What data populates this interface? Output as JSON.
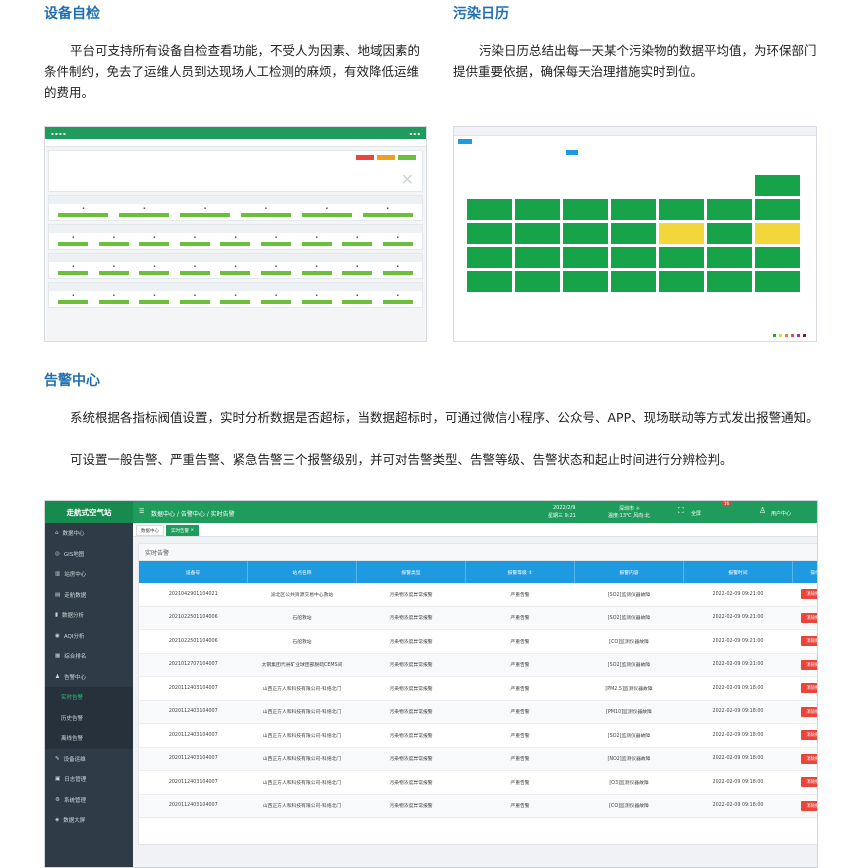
{
  "sections": {
    "self_check": {
      "title": "设备自检",
      "para": "平台可支持所有设备自检查看功能，不受人为因素、地域因素的条件制约，免去了运维人员到达现场人工检测的麻烦，有效降低运维的费用。"
    },
    "calendar": {
      "title": "污染日历",
      "para": "污染日历总结出每一天某个污染物的数据平均值，为环保部门提供重要依据，确保每天治理措施实时到位。"
    },
    "alarm": {
      "title": "告警中心",
      "para1": "系统根据各指标阀值设置，实时分析数据是否超标，当数据超标时，可通过微信小程序、公众号、APP、现场联动等方式发出报警通知。",
      "para2": "可设置一般告警、严重告警、紧急告警三个报警级别，并可对告警类型、告警等级、告警状态和起止时间进行分辨检判。"
    }
  },
  "app": {
    "logo": "走航式空气站",
    "breadcrumb": "数据中心 / 告警中心 / 实时告警",
    "date": "2022/2/9",
    "weekday_time": "星期三 9:21",
    "location": "深圳市 ☼",
    "weather": "温度:13℃ 风向:北",
    "fullscreen": "全屏",
    "badge": "16",
    "user": "用户中心",
    "tabs": [
      "数据中心",
      "实时告警"
    ],
    "panel_title": "实时告警",
    "sidebar": [
      {
        "label": "数据中心",
        "icon": "home-icon"
      },
      {
        "label": "GIS地图",
        "icon": "map-icon"
      },
      {
        "label": "站房中心",
        "icon": "station-icon"
      },
      {
        "label": "走航数据",
        "icon": "data-icon"
      },
      {
        "label": "数据分析",
        "icon": "chart-icon"
      },
      {
        "label": "AQI分析",
        "icon": "aqi-icon"
      },
      {
        "label": "综合排名",
        "icon": "rank-icon"
      },
      {
        "label": "告警中心",
        "icon": "bell-icon"
      },
      {
        "label": "实时告警",
        "sub": true,
        "active": true
      },
      {
        "label": "历史告警",
        "sub": true
      },
      {
        "label": "离线告警",
        "sub": true
      },
      {
        "label": "设备运维",
        "icon": "tool-icon"
      },
      {
        "label": "日志管理",
        "icon": "log-icon"
      },
      {
        "label": "系统管理",
        "icon": "settings-icon"
      },
      {
        "label": "数据大屏",
        "icon": "screen-icon"
      }
    ],
    "columns": [
      "设备号",
      "站点名称",
      "报警类型",
      "报警等级 ⇕",
      "报警内容",
      "报警时间",
      "操作"
    ],
    "rows": [
      [
        "2021042901104021",
        "渝北区公共资源交易中心救站",
        "污染物浓度异常报警",
        "严重告警",
        "[SO2]监测仪器故障",
        "2022-02-09 09:21:00",
        "消除报警"
      ],
      [
        "2021022501104006",
        "石船救站",
        "污染物浓度异常报警",
        "严重告警",
        "[SO2]监测仪器故障",
        "2022-02-09 09:21:00",
        "消除报警"
      ],
      [
        "2021022501104006",
        "石船救站",
        "污染物浓度异常报警",
        "严重告警",
        "[CO]监测仪器故障",
        "2022-02-09 09:21:00",
        "消除报警"
      ],
      [
        "2021012707104007",
        "太钢集团代县矿业球团部脱硫CEMS间",
        "污染物浓度异常报警",
        "严重告警",
        "[SO2]监测仪器故障",
        "2022-02-09 09:21:00",
        "消除报警"
      ],
      [
        "2020112403104007",
        "山西正方人和科技有限公司-科络北门",
        "污染物浓度异常报警",
        "严重告警",
        "[PM2.5]监测仪器故障",
        "2022-02-09 09:18:00",
        "消除报警"
      ],
      [
        "2020112403104007",
        "山西正方人和科技有限公司-科络北门",
        "污染物浓度异常报警",
        "严重告警",
        "[PM10]监测仪器故障",
        "2022-02-09 09:18:00",
        "消除报警"
      ],
      [
        "2020112403104007",
        "山西正方人和科技有限公司-科络北门",
        "污染物浓度异常报警",
        "严重告警",
        "[SO2]监测仪器故障",
        "2022-02-09 09:18:00",
        "消除报警"
      ],
      [
        "2020112403104007",
        "山西正方人和科技有限公司-科络北门",
        "污染物浓度异常报警",
        "严重告警",
        "[NO2]监测仪器故障",
        "2022-02-09 09:18:00",
        "消除报警"
      ],
      [
        "2020112403104007",
        "山西正方人和科技有限公司-科络北门",
        "污染物浓度异常报警",
        "严重告警",
        "[O3]监测仪器故障",
        "2022-02-09 09:18:00",
        "消除报警"
      ],
      [
        "2020112403104007",
        "山西正方人和科技有限公司-科络北门",
        "污染物浓度异常报警",
        "严重告警",
        "[CO]监测仪器故障",
        "2022-02-09 09:18:00",
        "消除报警"
      ]
    ]
  },
  "colors": {
    "brand_green": "#1f9b5b",
    "header_blue": "#1e9be0",
    "title_blue": "#1f6fb2",
    "alarm_red": "#e9453b",
    "cal_green": "#17a34a",
    "cal_yellow": "#f3d73a"
  }
}
